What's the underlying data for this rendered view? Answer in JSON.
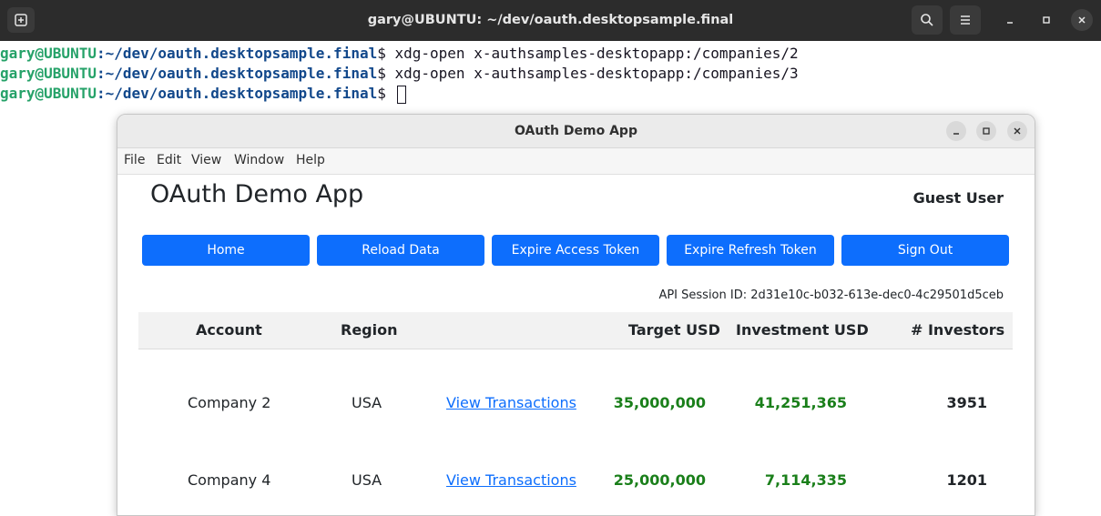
{
  "terminal": {
    "title": "gary@UBUNTU: ~/dev/oauth.desktopsample.final",
    "prompt_user": "gary@UBUNTU",
    "prompt_path": ":~/dev/oauth.desktopsample.final",
    "prompt_symbol": "$",
    "lines": [
      {
        "cmd": " xdg-open x-authsamples-desktopapp:/companies/2"
      },
      {
        "cmd": " xdg-open x-authsamples-desktopapp:/companies/3"
      },
      {
        "cmd": " "
      }
    ]
  },
  "app": {
    "window_title": "OAuth Demo App",
    "menu": [
      "File",
      "Edit",
      "View",
      "Window",
      "Help"
    ],
    "heading": "OAuth Demo App",
    "user": "Guest User",
    "buttons": [
      "Home",
      "Reload Data",
      "Expire Access Token",
      "Expire Refresh Token",
      "Sign Out"
    ],
    "session_label": "API Session ID: 2d31e10c-b032-613e-dec0-4c29501d5ceb",
    "table": {
      "headers": [
        "Account",
        "Region",
        "Target USD",
        "Investment USD",
        "# Investors"
      ],
      "rows": [
        {
          "account": "Company 2",
          "region": "USA",
          "link": "View Transactions",
          "target": "35,000,000",
          "investment": "41,251,365",
          "investors": "3951"
        },
        {
          "account": "Company 4",
          "region": "USA",
          "link": "View Transactions",
          "target": "25,000,000",
          "investment": "7,114,335",
          "investors": "1201"
        }
      ]
    }
  },
  "colors": {
    "terminal_user": "#26a269",
    "terminal_path": "#12488b",
    "button": "#0d6efd",
    "money": "#1a7f1a"
  }
}
